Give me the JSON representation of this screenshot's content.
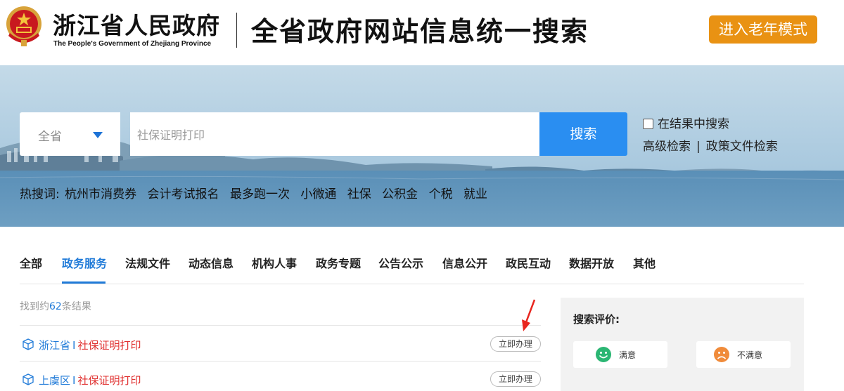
{
  "header": {
    "gov_name_cn": "浙江省人民政府",
    "gov_name_en": "The People's Government of Zhejiang Province",
    "site_title": "全省政府网站信息统一搜索",
    "elder_mode_label": "进入老年模式"
  },
  "search": {
    "scope_value": "全省",
    "query_value": "社保证明打印",
    "search_button_label": "搜索",
    "in_results_label": "在结果中搜索",
    "advanced_search_label": "高级检索",
    "separator": "|",
    "policy_search_label": "政策文件检索"
  },
  "hotwords": {
    "label": "热搜词:",
    "items": [
      "杭州市消费券",
      "会计考试报名",
      "最多跑一次",
      "小微通",
      "社保",
      "公积金",
      "个税",
      "就业"
    ]
  },
  "tabs": {
    "items": [
      "全部",
      "政务服务",
      "法规文件",
      "动态信息",
      "机构人事",
      "政务专题",
      "公告公示",
      "信息公开",
      "政民互动",
      "数据开放",
      "其他"
    ],
    "active": "政务服务"
  },
  "results": {
    "count_prefix": "找到约",
    "count": "62",
    "count_suffix": "条结果",
    "items": [
      {
        "region": "浙江省",
        "separator": "I",
        "title": "社保证明打印",
        "action": "立即办理"
      },
      {
        "region": "上虞区",
        "separator": "I",
        "title": "社保证明打印",
        "action": "立即办理"
      }
    ]
  },
  "evaluation": {
    "title": "搜索评价:",
    "satisfied_label": "满意",
    "unsatisfied_label": "不满意"
  },
  "colors": {
    "brand_blue": "#2a8ef1",
    "link_blue": "#1f7ad8",
    "elder_orange": "#e99213",
    "result_red": "#e0302f",
    "satisfied_green": "#2bb673",
    "unsatisfied_orange": "#f08b3a"
  },
  "icons": {
    "emblem": "national-emblem-icon",
    "scope_caret": "caret-down-icon",
    "result_item": "cube-icon",
    "satisfied": "smile-face-icon",
    "unsatisfied": "frown-face-icon"
  }
}
